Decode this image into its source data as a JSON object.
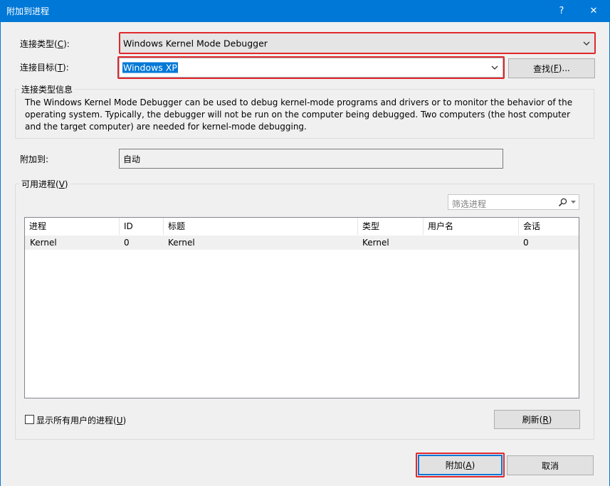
{
  "window": {
    "title": "附加到进程",
    "help_glyph": "?",
    "close_glyph": "✕"
  },
  "connection": {
    "type_label_prefix": "连接类型(",
    "type_label_key": "C",
    "type_label_suffix": "):",
    "type_value": "Windows Kernel Mode Debugger",
    "target_label_prefix": "连接目标(",
    "target_label_key": "T",
    "target_label_suffix": "):",
    "target_value": "Windows XP",
    "find_button_prefix": "查找(",
    "find_button_key": "F",
    "find_button_suffix": ")..."
  },
  "info": {
    "group_title": "连接类型信息",
    "text": "The Windows Kernel Mode Debugger can be used to debug kernel-mode programs and drivers or to monitor the behavior of the operating system. Typically, the debugger will not be run on the computer being debugged. Two computers (the host computer and the target computer) are needed for kernel-mode debugging."
  },
  "attach_to": {
    "label": "附加到:",
    "value": "自动"
  },
  "processes": {
    "group_title_prefix": "可用进程(",
    "group_title_key": "V",
    "group_title_suffix": ")",
    "filter_placeholder": "筛选进程",
    "columns": [
      "进程",
      "ID",
      "标题",
      "类型",
      "用户名",
      "会话"
    ],
    "rows": [
      {
        "process": "Kernel",
        "id": "0",
        "title": "Kernel",
        "type": "Kernel",
        "user": "",
        "session": "0"
      }
    ],
    "show_all_prefix": "显示所有用户的进程(",
    "show_all_key": "U",
    "show_all_suffix": ")",
    "show_all_checked": false,
    "refresh_prefix": "刷新(",
    "refresh_key": "R",
    "refresh_suffix": ")"
  },
  "footer": {
    "attach_prefix": "附加(",
    "attach_key": "A",
    "attach_suffix": ")",
    "cancel": "取消"
  },
  "colors": {
    "titlebar": "#0078d7",
    "highlight": "#e0282d",
    "selection": "#0078d7"
  }
}
